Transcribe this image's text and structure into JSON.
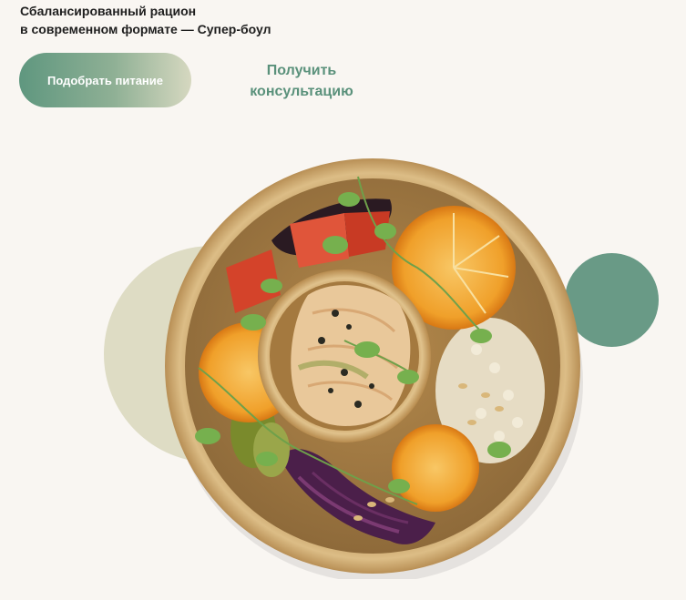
{
  "hero": {
    "subtitle_line1": "Сбалансированный рацион",
    "subtitle_line2": "в современном формате — Супер-боул",
    "primary_button_label": "Подобрать питание",
    "secondary_button_label": "Получить консультацию"
  },
  "colors": {
    "background": "#f9f6f2",
    "accent_green": "#699a86",
    "accent_beige": "#dedcc4",
    "text": "#1e1e1e",
    "link": "#5a917b"
  },
  "image": {
    "subject": "super-bowl-salmon-salad"
  }
}
